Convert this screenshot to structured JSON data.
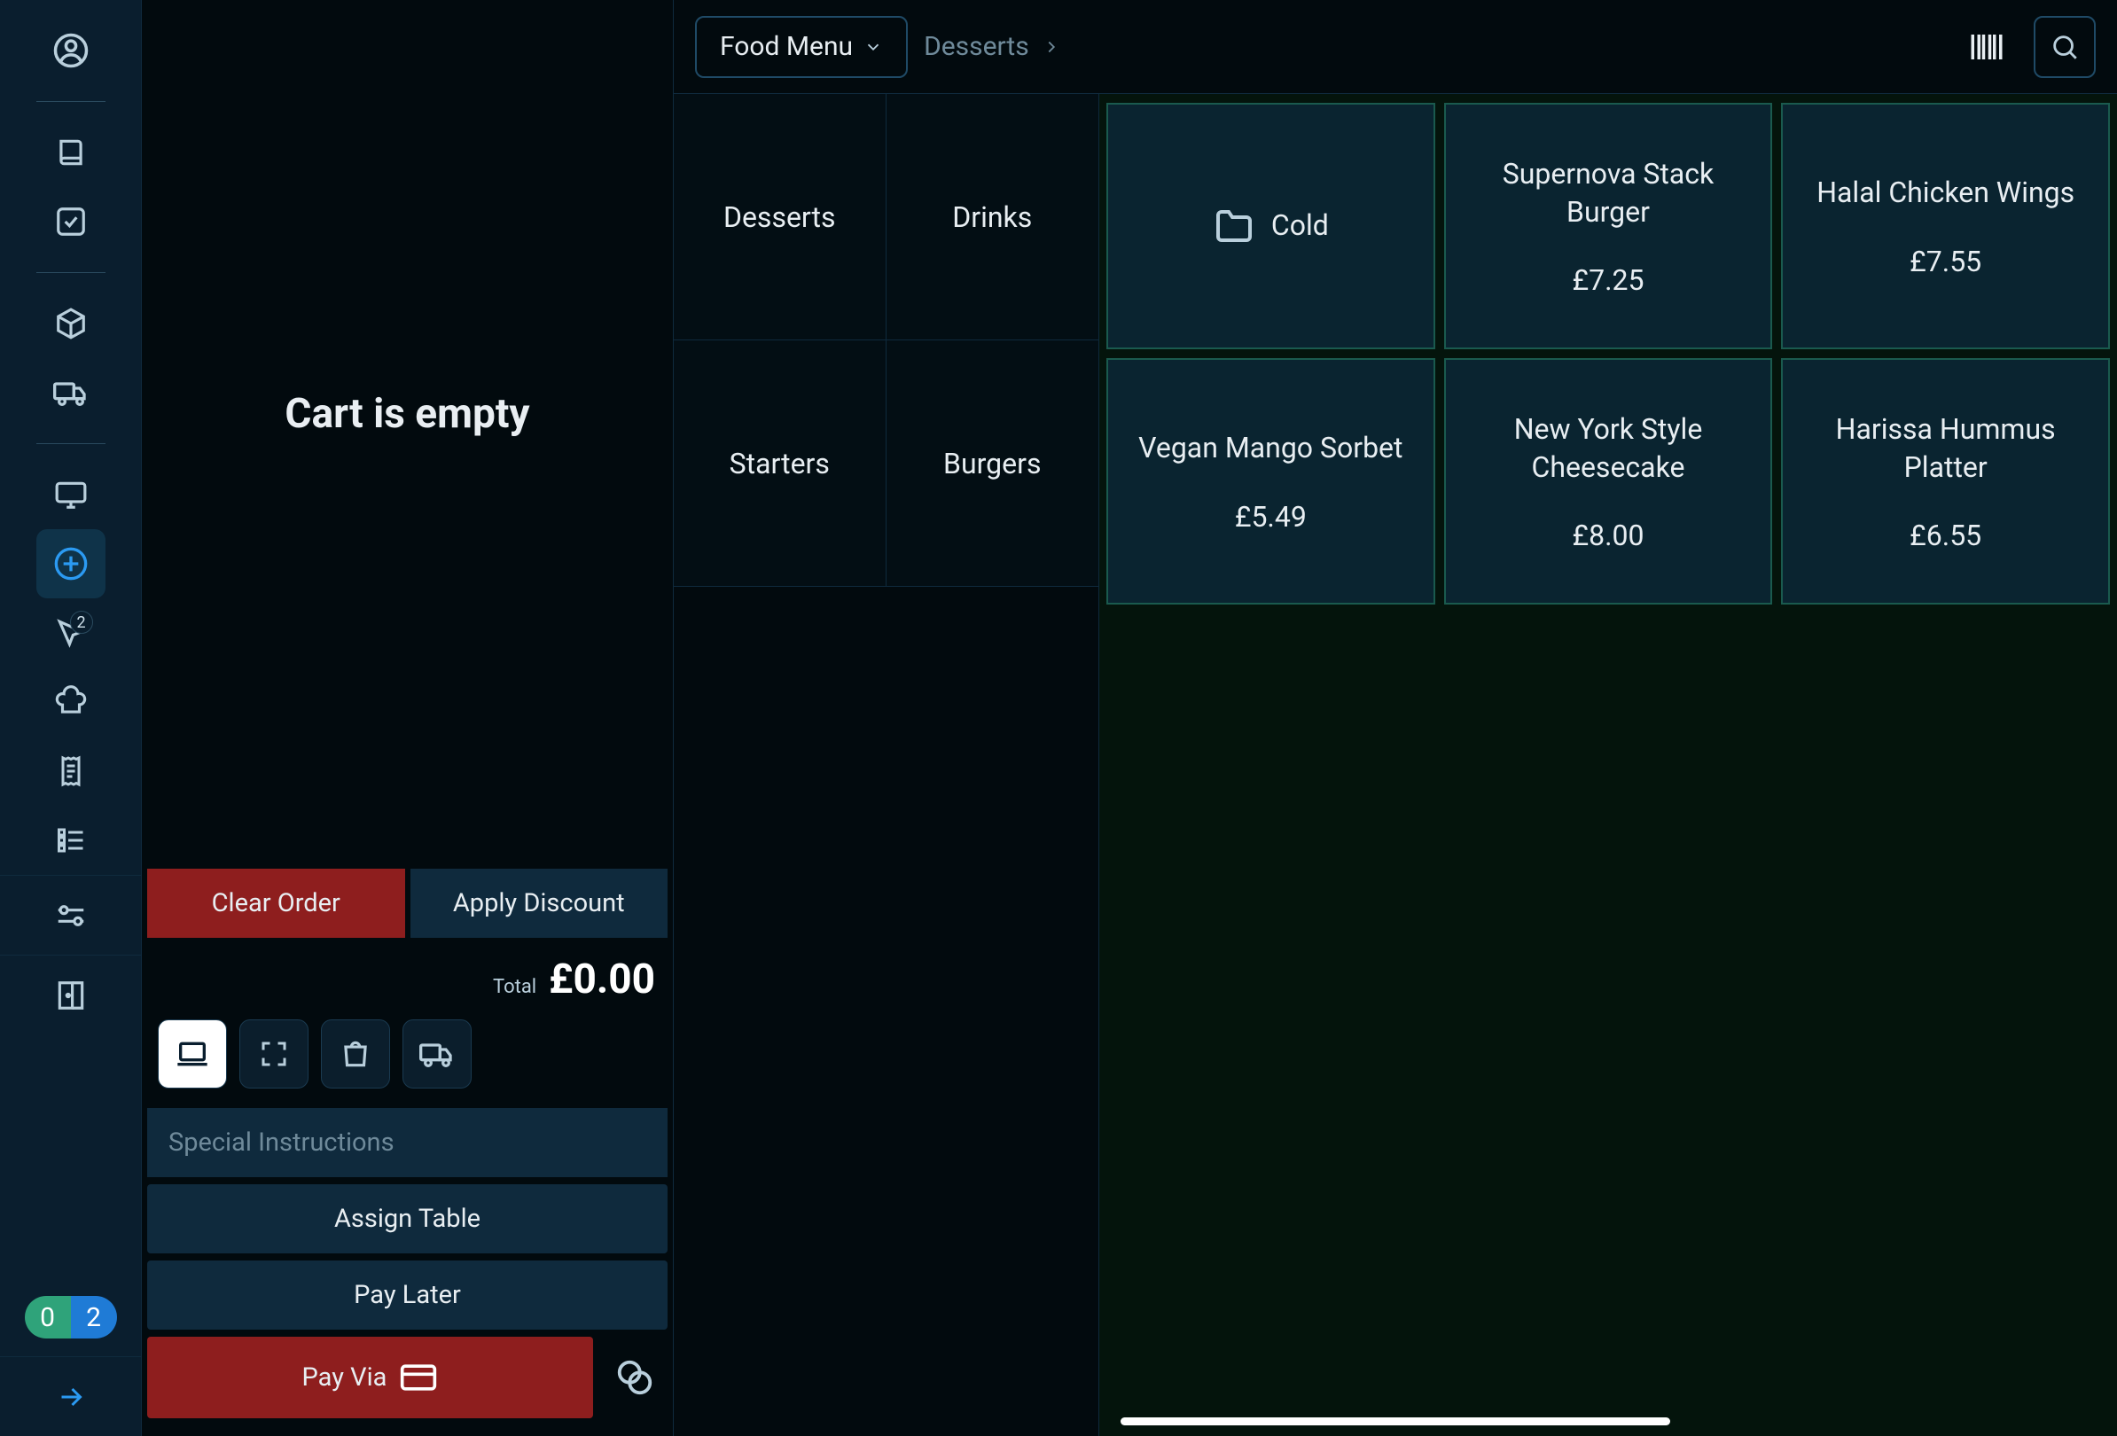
{
  "sidebar": {
    "cart_badge": "2",
    "status_left": "0",
    "status_right": "2"
  },
  "cart": {
    "empty_title": "Cart is empty",
    "clear_label": "Clear Order",
    "discount_label": "Apply Discount",
    "total_label": "Total",
    "total_amount": "£0.00",
    "instructions_placeholder": "Special Instructions",
    "assign_table_label": "Assign Table",
    "pay_later_label": "Pay Later",
    "pay_via_label": "Pay Via"
  },
  "menu": {
    "dropdown_label": "Food Menu",
    "breadcrumb": "Desserts",
    "categories": [
      "Desserts",
      "Drinks",
      "Starters",
      "Burgers"
    ],
    "folder": {
      "label": "Cold"
    },
    "products": [
      {
        "name": "Supernova Stack Burger",
        "price": "£7.25"
      },
      {
        "name": "Halal Chicken Wings",
        "price": "£7.55"
      },
      {
        "name": "Vegan Mango Sorbet",
        "price": "£5.49"
      },
      {
        "name": "New York Style Cheesecake",
        "price": "£8.00"
      },
      {
        "name": "Harissa Hummus Platter",
        "price": "£6.55"
      }
    ]
  }
}
